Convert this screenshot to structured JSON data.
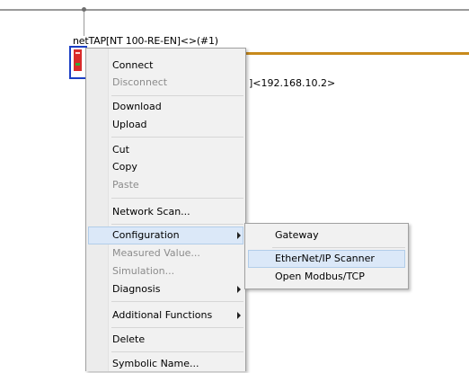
{
  "device": {
    "title": "netTAP[NT 100-RE-EN]<>(#1)",
    "ip_label": "]<192.168.10.2>"
  },
  "context_menu": {
    "items": [
      {
        "label": "Connect",
        "enabled": true
      },
      {
        "label": "Disconnect",
        "enabled": false
      },
      {
        "label": "Download",
        "enabled": true
      },
      {
        "label": "Upload",
        "enabled": true
      },
      {
        "label": "Cut",
        "enabled": true
      },
      {
        "label": "Copy",
        "enabled": true
      },
      {
        "label": "Paste",
        "enabled": false
      },
      {
        "label": "Network Scan...",
        "enabled": true
      },
      {
        "label": "Configuration",
        "enabled": true,
        "submenu": true,
        "highlighted": true
      },
      {
        "label": "Measured Value...",
        "enabled": false
      },
      {
        "label": "Simulation...",
        "enabled": false
      },
      {
        "label": "Diagnosis",
        "enabled": true,
        "submenu": true
      },
      {
        "label": "Additional Functions",
        "enabled": true,
        "submenu": true
      },
      {
        "label": "Delete",
        "enabled": true
      },
      {
        "label": "Symbolic Name...",
        "enabled": true
      }
    ]
  },
  "configuration_submenu": {
    "items": [
      {
        "label": "Gateway",
        "enabled": true
      },
      {
        "label": "EtherNet/IP Scanner",
        "enabled": true,
        "highlighted": true
      },
      {
        "label": "Open Modbus/TCP",
        "enabled": true
      }
    ]
  },
  "colors": {
    "selection_bg": "#dbe8f8",
    "selection_border": "#b2cde9",
    "device_border": "#1c3fc4",
    "device_chip": "#d92b2b",
    "connection_line": "#c88a1c"
  }
}
